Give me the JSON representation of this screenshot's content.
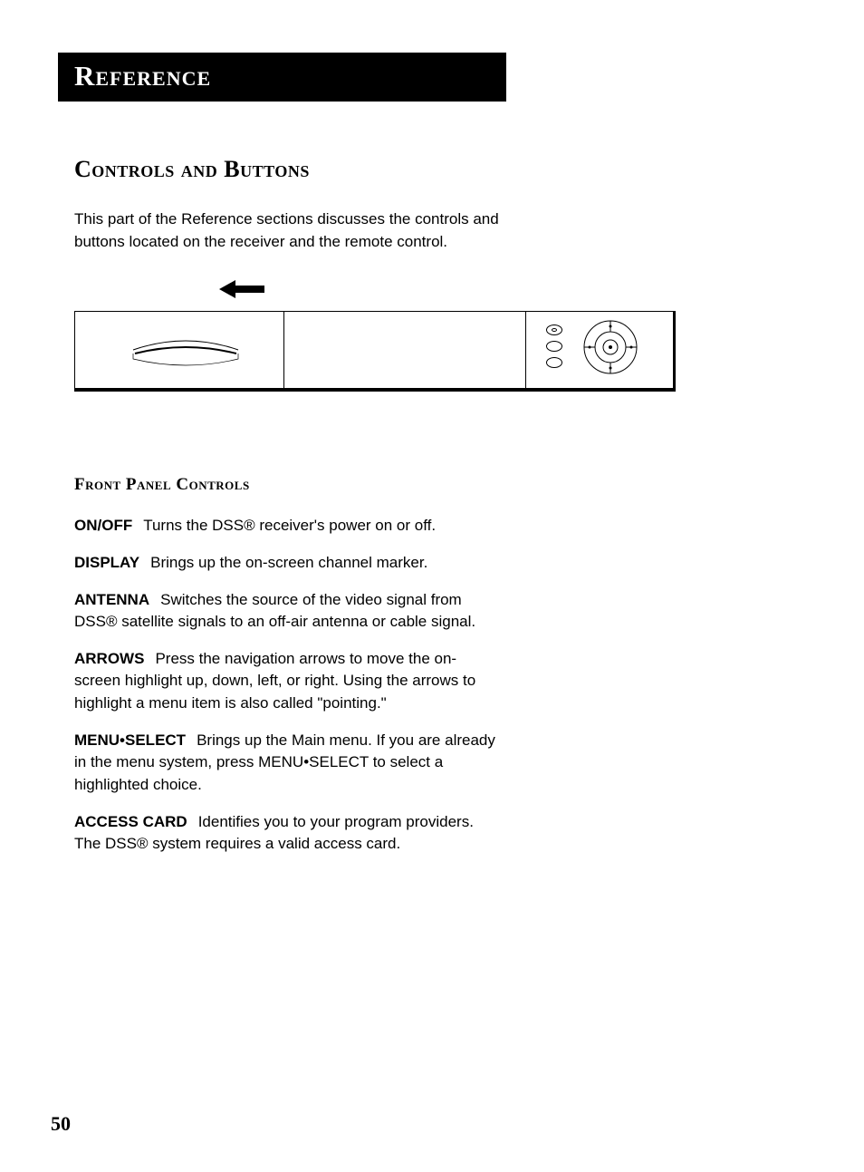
{
  "header": {
    "title": "Reference"
  },
  "section": {
    "heading": "Controls and Buttons",
    "intro": "This part of the Reference sections discusses the controls and buttons located on the receiver and the remote control."
  },
  "subsection": {
    "heading": "Front Panel Controls",
    "items": [
      {
        "term": "ON/OFF",
        "desc": "Turns the DSS® receiver's power on or off."
      },
      {
        "term": "DISPLAY",
        "desc": "Brings up the on-screen channel marker."
      },
      {
        "term": "ANTENNA",
        "desc": "Switches the source of the video signal from DSS® satellite signals to an off-air antenna or cable signal."
      },
      {
        "term": "ARROWS",
        "desc": "Press the navigation arrows to move the on-screen highlight up, down, left, or right.  Using the arrows to highlight a menu item is also called \"pointing.\""
      },
      {
        "term": "MENU•SELECT",
        "desc": "Brings up the Main menu.  If you are already in the menu system, press MENU•SELECT to select a highlighted choice."
      },
      {
        "term": "ACCESS CARD",
        "desc": "Identifies you to your program providers.  The DSS® system requires a valid access card."
      }
    ]
  },
  "page_number": "50"
}
